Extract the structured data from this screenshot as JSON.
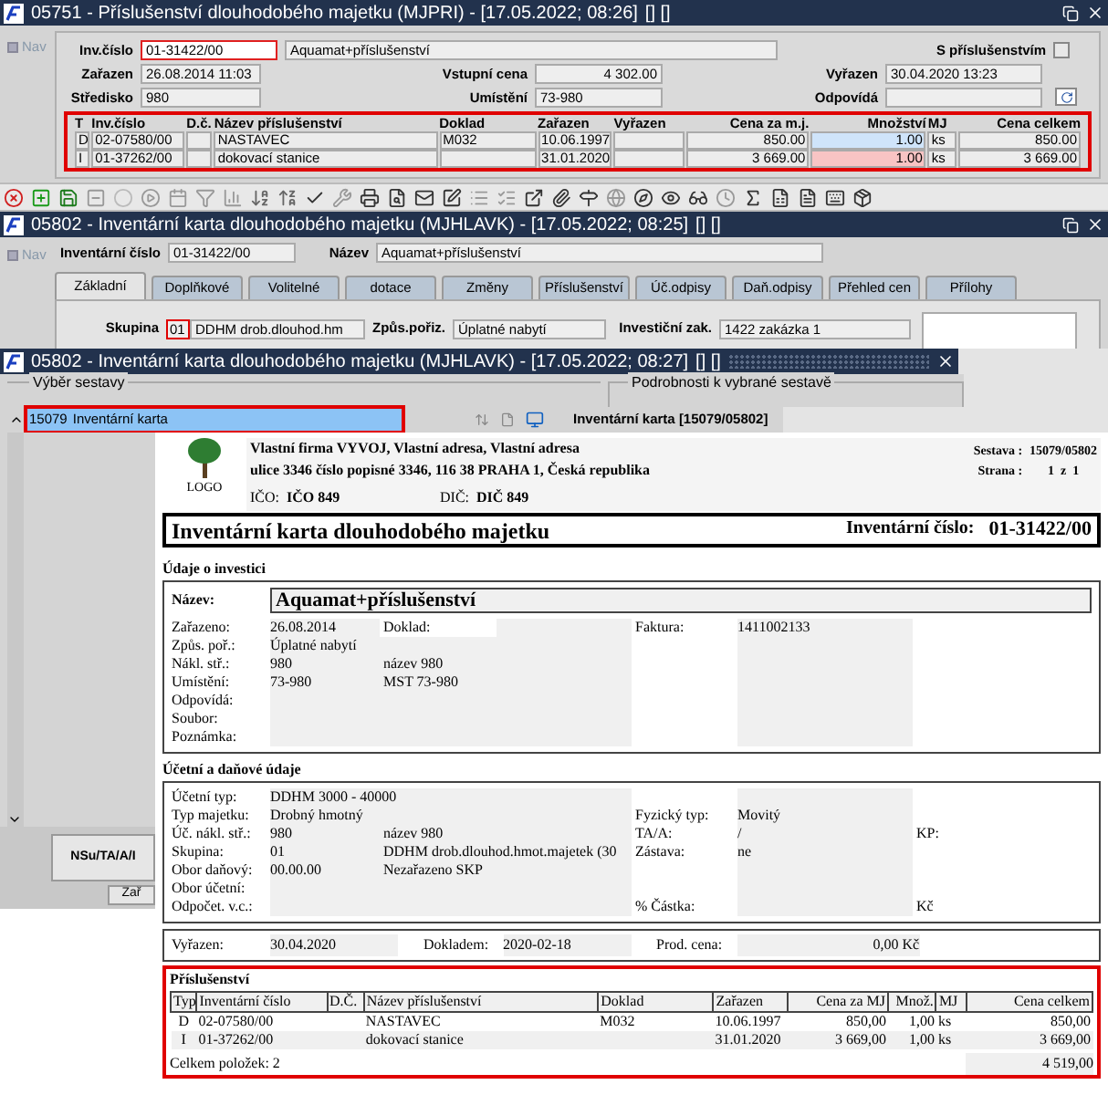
{
  "window1": {
    "title": "05751 - Příslušenství dlouhodobého majetku (MJPRI) - [17.05.2022; 08:26]",
    "title_suffix": "[] []",
    "nav": "Nav",
    "inv": {
      "label": "Inv.číslo",
      "value": "01-31422/00",
      "focused": true
    },
    "name": {
      "value": "Aquamat+příslušenství"
    },
    "with_accessories": {
      "label": "S příslušenstvím",
      "checked": false
    },
    "fields": [
      {
        "label": "Zařazen",
        "value": "26.08.2014 11:03"
      },
      {
        "label": "Vstupní cena",
        "value": "4 302.00"
      },
      {
        "label": "Vyřazen",
        "value": "30.04.2020 13:23"
      },
      {
        "label": "Středisko",
        "value": "980"
      },
      {
        "label": "Umístění",
        "value": "73-980"
      },
      {
        "label": "Odpovídá"
      }
    ],
    "table": {
      "highlighted": true,
      "columns": [
        "T",
        "Inv.číslo",
        "D.č.",
        "Název příslušenství",
        "Doklad",
        "Zařazen",
        "Vyřazen",
        "Cena za m.j.",
        "Množství",
        "MJ",
        "Cena celkem"
      ],
      "rows": [
        {
          "t": "D",
          "inv": "02-07580/00",
          "name": "NASTAVEC",
          "doc": "M032",
          "added": "10.06.1997",
          "price": "850.00",
          "qty": "1.00",
          "unit": "ks",
          "total": "850.00",
          "color": "#cfe4fa"
        },
        {
          "t": "I",
          "inv": "01-37262/00",
          "name": "dokovací stanice",
          "added": "31.01.2020",
          "price": "3 669.00",
          "qty": "1.00",
          "unit": "ks",
          "total": "3 669.00",
          "color": "#f8c4c4"
        }
      ]
    }
  },
  "window2": {
    "title": "05802 - Inventární karta dlouhodobého majetku (MJHLAVK) - [17.05.2022; 08:25]",
    "title_suffix": "[] []",
    "nav": "Nav",
    "inv": {
      "label": "Inventární číslo",
      "value": "01-31422/00"
    },
    "name": {
      "label": "Název",
      "value": "Aquamat+příslušenství"
    },
    "tabs": [
      {
        "label": "Základní",
        "selected": true
      },
      {
        "label": "Doplňkové",
        "selected": false
      },
      {
        "label": "Volitelné",
        "selected": false
      },
      {
        "label": "dotace",
        "selected": false
      },
      {
        "label": "Změny",
        "selected": false
      },
      {
        "label": "Příslušenství",
        "selected": false
      },
      {
        "label": "Úč.odpisy",
        "selected": false
      },
      {
        "label": "Daň.odpisy",
        "selected": false
      },
      {
        "label": "Přehled cen",
        "selected": false
      },
      {
        "label": "Přílohy",
        "selected": false
      }
    ],
    "group": {
      "label": "Skupina",
      "code": "01",
      "value": "DDHM drob.dlouhod.hm",
      "highlighted": true
    },
    "acquisition": {
      "label": "Způs.pořiz.",
      "value": "Úplatné nabytí"
    },
    "order": {
      "label": "Investiční zak.",
      "value": "1422 zakázka 1"
    }
  },
  "window3": {
    "title": "05802 - Inventární karta dlouhodobého majetku (MJHLAVK) - [17.05.2022; 08:27]",
    "title_suffix": "[] []",
    "selection": {
      "label": "Výběr sestavy",
      "items": [
        {
          "code": "15079",
          "name": "Inventární karta",
          "selected": true,
          "highlighted": true
        }
      ]
    },
    "details": {
      "label": "Podrobnosti k vybrané sestavě",
      "value": "Inventární karta [15079/05802]"
    },
    "buttons": [
      "NSu/TA/A/I",
      "Zař"
    ],
    "report": {
      "logo": "LOGO",
      "company": "Vlastní firma VYVOJ, Vlastní adresa, Vlastní adresa",
      "address": "ulice 3346 číslo popisné 3346, 116 38 PRAHA 1, Česká republika",
      "ico": {
        "label": "IČO:",
        "value": "IČO 849"
      },
      "dic": {
        "label": "DIČ:",
        "value": "DIČ 849"
      },
      "set": {
        "label": "Sestava :",
        "value": "15079/05802"
      },
      "page": {
        "label": "Strana :",
        "value": "1  z  1"
      },
      "title": "Inventární karta dlouhodobého majetku",
      "inv": {
        "label": "Inventární číslo:",
        "value": "01-31422/00"
      },
      "investment": {
        "title": "Údaje o investici",
        "name": {
          "label": "Název:",
          "value": "Aquamat+příslušenství"
        },
        "rows": [
          {
            "label": "Zařazeno:",
            "value": "26.08.2014",
            "mid_label": "Doklad:",
            "right_label": "Faktura:",
            "right_value": "1411002133"
          },
          {
            "label": "Způs. poř.:",
            "value": "Úplatné nabytí"
          },
          {
            "label": "Nákl. stř.:",
            "value": "980",
            "mid_value": "název 980"
          },
          {
            "label": "Umístění:",
            "value": "73-980",
            "mid_value": "MST 73-980"
          },
          {
            "label": "Odpovídá:"
          },
          {
            "label": "Soubor:"
          },
          {
            "label": "Poznámka:"
          }
        ]
      },
      "accounting": {
        "title": "Účetní a daňové údaje",
        "rows": [
          {
            "label": "Účetní typ:",
            "value": "DDHM 3000 - 40000"
          },
          {
            "label": "Typ majetku:",
            "value": "Drobný hmotný",
            "right_label": "Fyzický typ:",
            "right_value": "Movitý"
          },
          {
            "label": "Úč. nákl. stř.:",
            "value": "980",
            "mid_value": "název 980",
            "right_label": "TA/A:",
            "right_value": "/",
            "far_label": "KP:"
          },
          {
            "label": "Skupina:",
            "value": "01",
            "mid_value": "DDHM drob.dlouhod.hmot.majetek (30",
            "right_label": "Zástava:",
            "right_value": "ne"
          },
          {
            "label": "Obor daňový:",
            "value": "00.00.00",
            "mid_value": "Nezařazeno SKP"
          },
          {
            "label": "Obor účetní:"
          },
          {
            "label": "Odpočet. v.c.:",
            "right_label": "%  Částka:",
            "far_label": "Kč"
          }
        ]
      },
      "disposal": [
        {
          "label": "Vyřazen:",
          "value": "30.04.2020"
        },
        {
          "label": "Dokladem:",
          "value": "2020-02-18"
        },
        {
          "label": "Prod. cena:",
          "value": "0,00 Kč"
        }
      ],
      "accessories": {
        "title": "Příslušenství",
        "highlighted": true,
        "columns": [
          "Typ",
          "Inventární číslo",
          "D.Č.",
          "Název příslušenství",
          "Doklad",
          "Zařazen",
          "Cena za MJ",
          "Množ.",
          "MJ",
          "Cena celkem"
        ],
        "rows": [
          {
            "t": "D",
            "inv": "02-07580/00",
            "name": "NASTAVEC",
            "doc": "M032",
            "added": "10.06.1997",
            "price": "850,00",
            "qty": "1,00",
            "unit": "ks",
            "total": "850,00"
          },
          {
            "t": "I",
            "inv": "01-37262/00",
            "name": "dokovací stanice",
            "added": "31.01.2020",
            "price": "3 669,00",
            "qty": "1,00",
            "unit": "ks",
            "total": "3 669,00"
          }
        ],
        "count": "Celkem položek: 2",
        "sum": "4 519,00"
      }
    }
  }
}
